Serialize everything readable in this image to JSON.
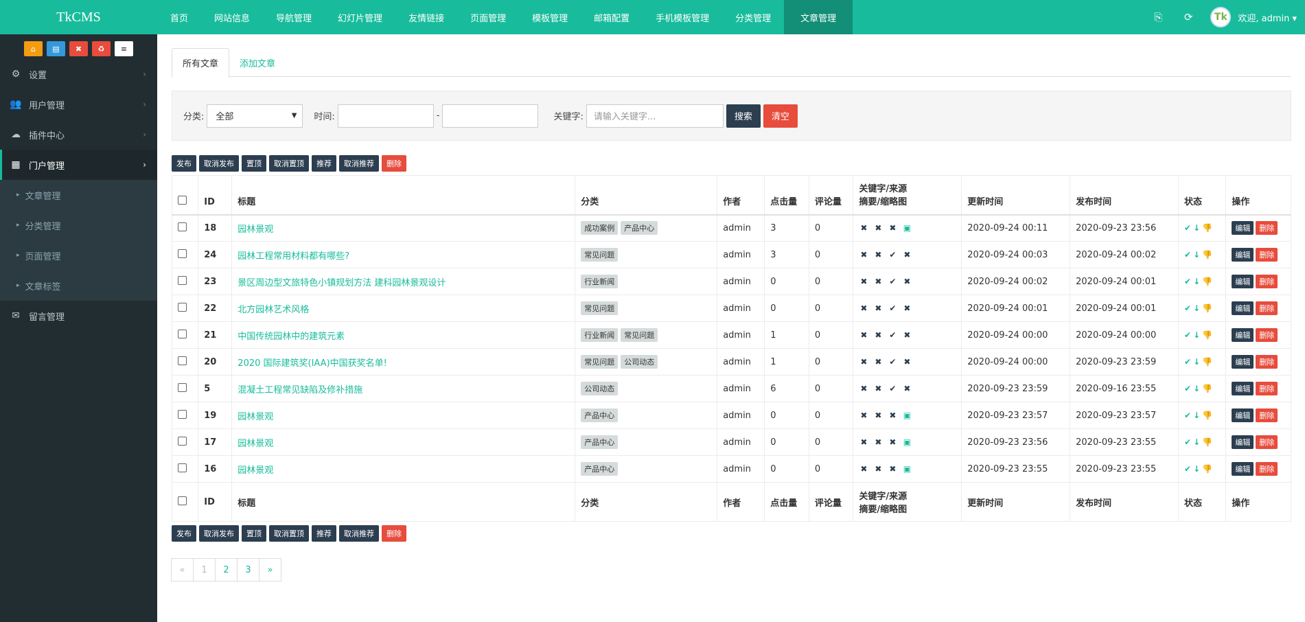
{
  "brand": "TkCMS",
  "nav": [
    "首页",
    "网站信息",
    "导航管理",
    "幻灯片管理",
    "友情链接",
    "页面管理",
    "模板管理",
    "邮箱配置",
    "手机模板管理",
    "分类管理",
    "文章管理"
  ],
  "nav_active": "文章管理",
  "user": {
    "avatar": "Tk",
    "welcome": "欢迎, admin ▾"
  },
  "sidebar": {
    "quick_buttons": [
      {
        "icon": "home-icon",
        "color": "#f39c12",
        "glyph": "⌂"
      },
      {
        "icon": "file-icon",
        "color": "#3498db",
        "glyph": "▤"
      },
      {
        "icon": "trash-icon",
        "color": "#e74c3c",
        "glyph": "✖"
      },
      {
        "icon": "recycle-icon",
        "color": "#e74c3c",
        "glyph": "♻"
      },
      {
        "icon": "list-icon",
        "color": "#ffffff",
        "glyph": "≡"
      }
    ],
    "items": [
      {
        "label": "设置",
        "icon": "⚙"
      },
      {
        "label": "用户管理",
        "icon": "👥"
      },
      {
        "label": "插件中心",
        "icon": "☁"
      },
      {
        "label": "门户管理",
        "icon": "▦"
      }
    ],
    "sub_items": [
      "文章管理",
      "分类管理",
      "页面管理",
      "文章标签"
    ],
    "last_item": {
      "label": "留言管理",
      "icon": "✉"
    }
  },
  "tabs": [
    "所有文章",
    "添加文章"
  ],
  "filter": {
    "category_label": "分类:",
    "category_value": "全部",
    "time_label": "时间:",
    "dash": "-",
    "keyword_label": "关键字:",
    "keyword_placeholder": "请输入关键字...",
    "search_btn": "搜索",
    "clear_btn": "清空"
  },
  "actions": [
    "发布",
    "取消发布",
    "置顶",
    "取消置顶",
    "推荐",
    "取消推荐",
    "删除"
  ],
  "table": {
    "headers": [
      "ID",
      "标题",
      "分类",
      "作者",
      "点击量",
      "评论量",
      "关键字/来源",
      "摘要/缩略图",
      "更新时间",
      "发布时间",
      "状态",
      "操作"
    ],
    "rows": [
      {
        "id": "18",
        "title": "园林景观",
        "tags": [
          "成功案例",
          "产品中心"
        ],
        "author": "admin",
        "clicks": "3",
        "comments": "0",
        "marks": [
          "✖",
          "✖",
          "✖",
          "img"
        ],
        "updated": "2020-09-24 00:11",
        "published": "2020-09-23 23:56"
      },
      {
        "id": "24",
        "title": "园林工程常用材料都有哪些?",
        "tags": [
          "常见问题"
        ],
        "author": "admin",
        "clicks": "3",
        "comments": "0",
        "marks": [
          "✖",
          "✖",
          "✔",
          "✖"
        ],
        "updated": "2020-09-24 00:03",
        "published": "2020-09-24 00:02"
      },
      {
        "id": "23",
        "title": "景区周边型文旅特色小镇规划方法 建科园林景观设计",
        "tags": [
          "行业新闻"
        ],
        "author": "admin",
        "clicks": "0",
        "comments": "0",
        "marks": [
          "✖",
          "✖",
          "✔",
          "✖"
        ],
        "updated": "2020-09-24 00:02",
        "published": "2020-09-24 00:01"
      },
      {
        "id": "22",
        "title": "北方园林艺术风格",
        "tags": [
          "常见问题"
        ],
        "author": "admin",
        "clicks": "0",
        "comments": "0",
        "marks": [
          "✖",
          "✖",
          "✔",
          "✖"
        ],
        "updated": "2020-09-24 00:01",
        "published": "2020-09-24 00:01"
      },
      {
        "id": "21",
        "title": "中国传统园林中的建筑元素",
        "tags": [
          "行业新闻",
          "常见问题"
        ],
        "author": "admin",
        "clicks": "1",
        "comments": "0",
        "marks": [
          "✖",
          "✖",
          "✔",
          "✖"
        ],
        "updated": "2020-09-24 00:00",
        "published": "2020-09-24 00:00"
      },
      {
        "id": "20",
        "title": "2020 国际建筑奖(IAA)中国获奖名单!",
        "tags": [
          "常见问题",
          "公司动态"
        ],
        "author": "admin",
        "clicks": "1",
        "comments": "0",
        "marks": [
          "✖",
          "✖",
          "✔",
          "✖"
        ],
        "updated": "2020-09-24 00:00",
        "published": "2020-09-23 23:59"
      },
      {
        "id": "5",
        "title": "混凝土工程常见缺陷及修补措施",
        "tags": [
          "公司动态"
        ],
        "author": "admin",
        "clicks": "6",
        "comments": "0",
        "marks": [
          "✖",
          "✖",
          "✔",
          "✖"
        ],
        "updated": "2020-09-23 23:59",
        "published": "2020-09-16 23:55"
      },
      {
        "id": "19",
        "title": "园林景观",
        "tags": [
          "产品中心"
        ],
        "author": "admin",
        "clicks": "0",
        "comments": "0",
        "marks": [
          "✖",
          "✖",
          "✖",
          "img"
        ],
        "updated": "2020-09-23 23:57",
        "published": "2020-09-23 23:57"
      },
      {
        "id": "17",
        "title": "园林景观",
        "tags": [
          "产品中心"
        ],
        "author": "admin",
        "clicks": "0",
        "comments": "0",
        "marks": [
          "✖",
          "✖",
          "✖",
          "img"
        ],
        "updated": "2020-09-23 23:56",
        "published": "2020-09-23 23:55"
      },
      {
        "id": "16",
        "title": "园林景观",
        "tags": [
          "产品中心"
        ],
        "author": "admin",
        "clicks": "0",
        "comments": "0",
        "marks": [
          "✖",
          "✖",
          "✖",
          "img"
        ],
        "updated": "2020-09-23 23:55",
        "published": "2020-09-23 23:55"
      }
    ],
    "row_ops": {
      "edit": "编辑",
      "delete": "删除"
    },
    "status_icons": [
      "check-icon",
      "arrow-down-icon",
      "thumbs-down-icon"
    ]
  },
  "pagination": [
    "«",
    "1",
    "2",
    "3",
    "»"
  ]
}
